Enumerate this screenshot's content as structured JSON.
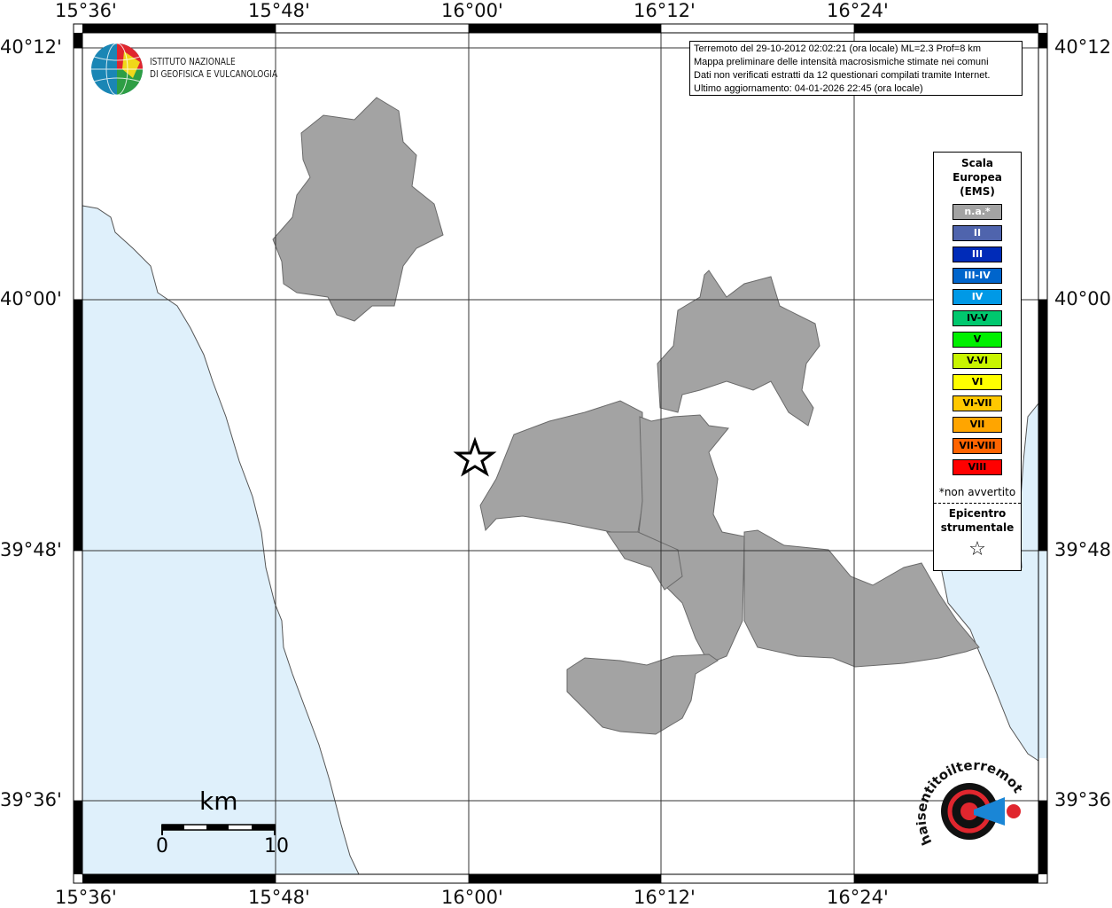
{
  "map": {
    "lon_labels": [
      "15°36'",
      "15°48'",
      "16°00'",
      "16°12'",
      "16°24'"
    ],
    "lat_labels": [
      "40°12'",
      "40°00'",
      "39°48'",
      "39°36'"
    ],
    "colors": {
      "sea": "#dff0fb",
      "municipality": "#a3a3a3",
      "land": "#ffffff"
    },
    "epicenter_icon": "star-outline-icon"
  },
  "info": {
    "line1": "Terremoto del 29-10-2012 02:02:21 (ora locale) ML=2.3 Prof=8 km",
    "line2": "Mappa preliminare delle intensità macrosismiche stimate nei comuni",
    "line3": "Dati non verificati estratti da 12 questionari compilati tramite Internet.",
    "line4": "Ultimo aggiornamento: 04-01-2026 22:45 (ora locale)"
  },
  "legend": {
    "title1": "Scala",
    "title2": "Europea",
    "title3": "(EMS)",
    "items": [
      {
        "label": "n.a.*",
        "color": "#a3a3a3",
        "text": "#ffffff"
      },
      {
        "label": "II",
        "color": "#4f64ad",
        "text": "#ffffff"
      },
      {
        "label": "III",
        "color": "#002bb8",
        "text": "#ffffff"
      },
      {
        "label": "III-IV",
        "color": "#0065cc",
        "text": "#ffffff"
      },
      {
        "label": "IV",
        "color": "#0099e6",
        "text": "#ffffff"
      },
      {
        "label": "IV-V",
        "color": "#00c86e",
        "text": "#000000"
      },
      {
        "label": "V",
        "color": "#00f000",
        "text": "#000000"
      },
      {
        "label": "V-VI",
        "color": "#c8f500",
        "text": "#000000"
      },
      {
        "label": "VI",
        "color": "#ffff00",
        "text": "#000000"
      },
      {
        "label": "VI-VII",
        "color": "#ffc800",
        "text": "#000000"
      },
      {
        "label": "VII",
        "color": "#ffa500",
        "text": "#000000"
      },
      {
        "label": "VII-VIII",
        "color": "#ff6400",
        "text": "#000000"
      },
      {
        "label": "VIII",
        "color": "#ff0000",
        "text": "#000000"
      }
    ],
    "note": "*non avvertito",
    "epicenter1": "Epicentro",
    "epicenter2": "strumentale",
    "epicenter_symbol": "☆"
  },
  "logos": {
    "ingv_line1": "ISTITUTO NAZIONALE",
    "ingv_line2": "DI GEOFISICA E VULCANOLOGIA",
    "hsi": "www.haisentitoilterremoto.it"
  },
  "scalebar": {
    "unit": "km",
    "min": "0",
    "max": "10"
  }
}
